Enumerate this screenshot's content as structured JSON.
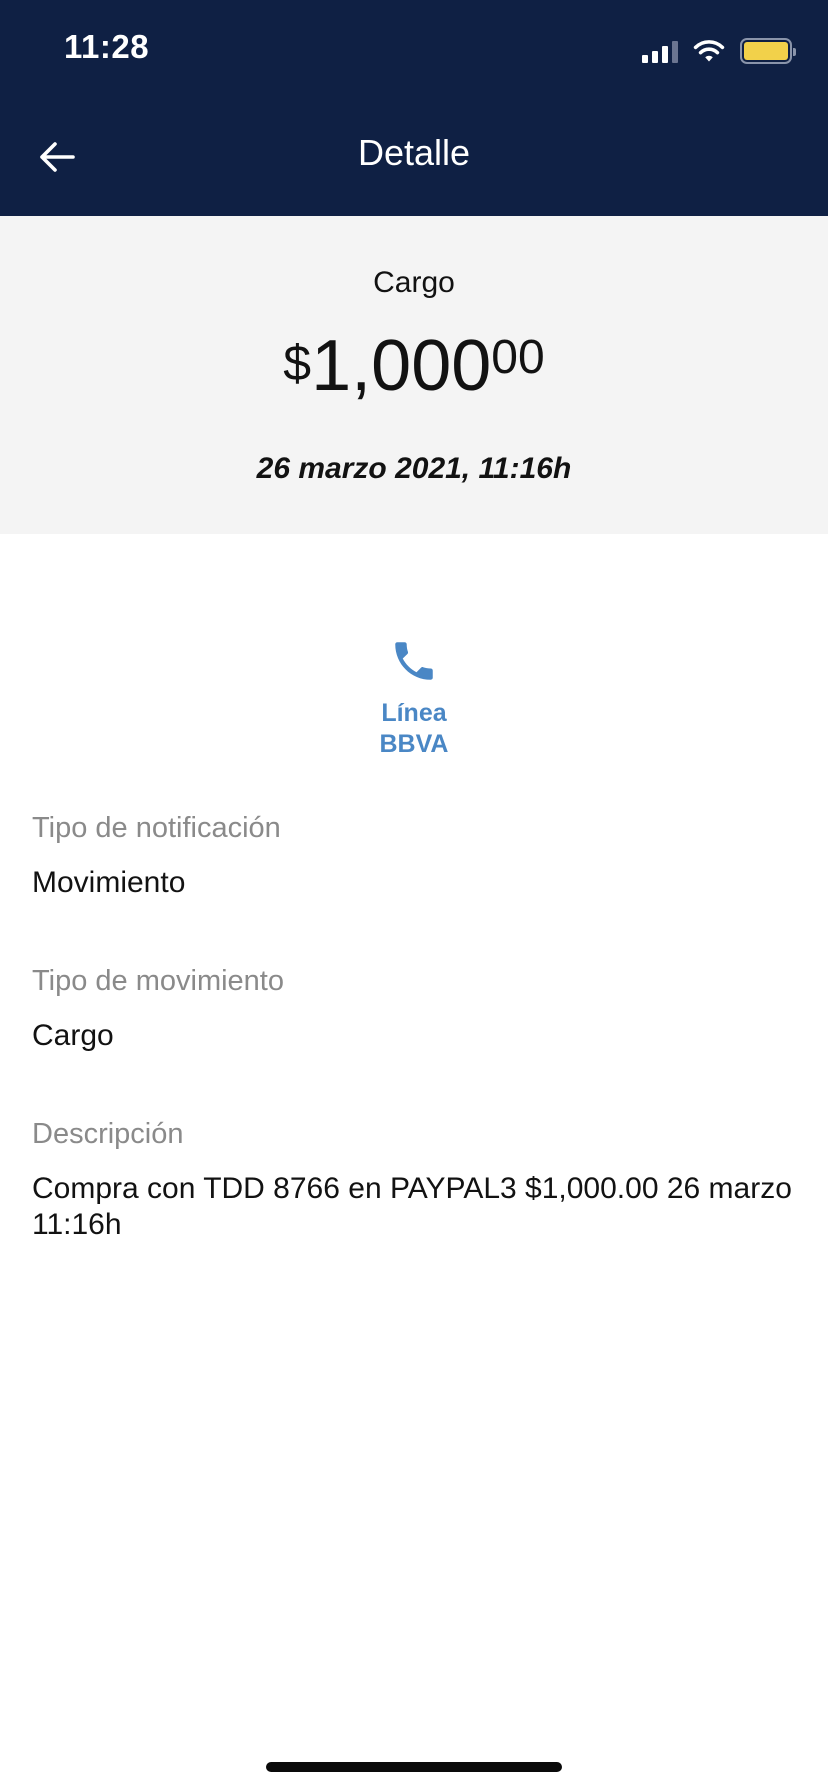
{
  "status_bar": {
    "time": "11:28"
  },
  "nav": {
    "title": "Detalle",
    "back_icon": "arrow-left-icon"
  },
  "summary": {
    "type": "Cargo",
    "amount": {
      "currency": "$",
      "whole": "1,000",
      "cents": "00"
    },
    "date": "26 marzo 2021, 11:16h"
  },
  "contact": {
    "icon": "phone-icon",
    "label_line1": "Línea",
    "label_line2": "BBVA"
  },
  "details": [
    {
      "label": "Tipo de notificación",
      "value": "Movimiento"
    },
    {
      "label": "Tipo de movimiento",
      "value": "Cargo"
    },
    {
      "label": "Descripción",
      "value": "Compra con TDD 8766 en PAYPAL3 $1,000.00 26 marzo 11:16h"
    }
  ],
  "colors": {
    "header_bg": "#0f2044",
    "summary_bg": "#f4f4f4",
    "accent": "#4a87c5",
    "battery": "#f2d14a"
  }
}
